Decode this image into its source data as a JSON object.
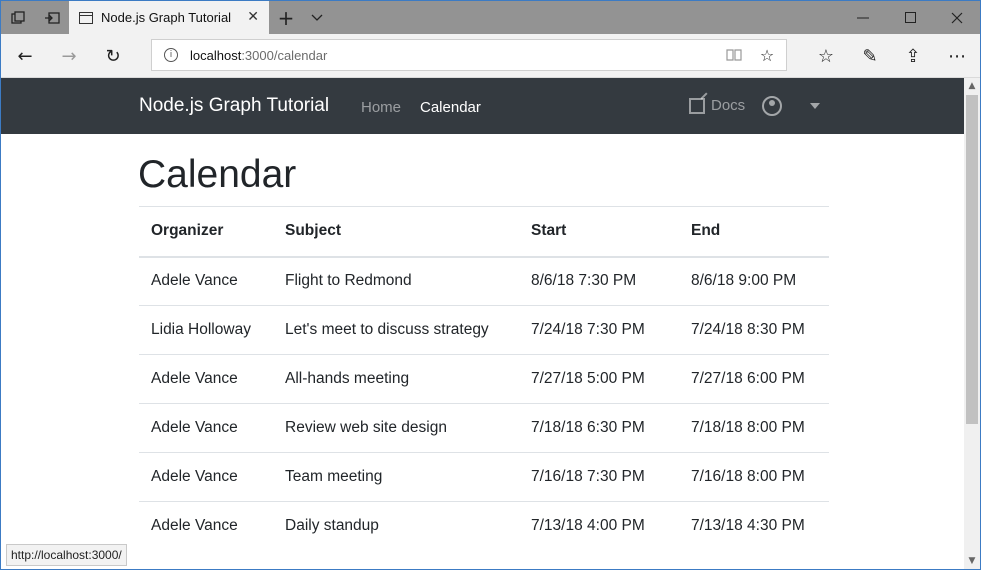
{
  "browser": {
    "tab_title": "Node.js Graph Tutorial",
    "tab_close": "✕",
    "new_tab": "+",
    "tab_menu": "⌵",
    "window_controls": {
      "minimize": "—",
      "maximize": "☐",
      "close": "✕"
    },
    "address": {
      "host": "localhost",
      "path": ":3000/calendar",
      "info": "i"
    },
    "nav": {
      "back": "←",
      "forward": "→",
      "refresh": "↻"
    },
    "addr_icons": {
      "reading": "▯",
      "favorite": "☆"
    },
    "right_icons": {
      "favorites": "☆",
      "notes": "✎",
      "share": "⇪",
      "more": "⋯"
    },
    "status_url": "http://localhost:3000/"
  },
  "app": {
    "brand": "Node.js Graph Tutorial",
    "nav": {
      "home": "Home",
      "calendar": "Calendar"
    },
    "docs": "Docs"
  },
  "page": {
    "title": "Calendar",
    "columns": {
      "organizer": "Organizer",
      "subject": "Subject",
      "start": "Start",
      "end": "End"
    },
    "rows": [
      {
        "organizer": "Adele Vance",
        "subject": "Flight to Redmond",
        "start": "8/6/18 7:30 PM",
        "end": "8/6/18 9:00 PM"
      },
      {
        "organizer": "Lidia Holloway",
        "subject": "Let's meet to discuss strategy",
        "start": "7/24/18 7:30 PM",
        "end": "7/24/18 8:30 PM"
      },
      {
        "organizer": "Adele Vance",
        "subject": "All-hands meeting",
        "start": "7/27/18 5:00 PM",
        "end": "7/27/18 6:00 PM"
      },
      {
        "organizer": "Adele Vance",
        "subject": "Review web site design",
        "start": "7/18/18 6:30 PM",
        "end": "7/18/18 8:00 PM"
      },
      {
        "organizer": "Adele Vance",
        "subject": "Team meeting",
        "start": "7/16/18 7:30 PM",
        "end": "7/16/18 8:00 PM"
      },
      {
        "organizer": "Adele Vance",
        "subject": "Daily standup",
        "start": "7/13/18 4:00 PM",
        "end": "7/13/18 4:30 PM"
      }
    ]
  }
}
